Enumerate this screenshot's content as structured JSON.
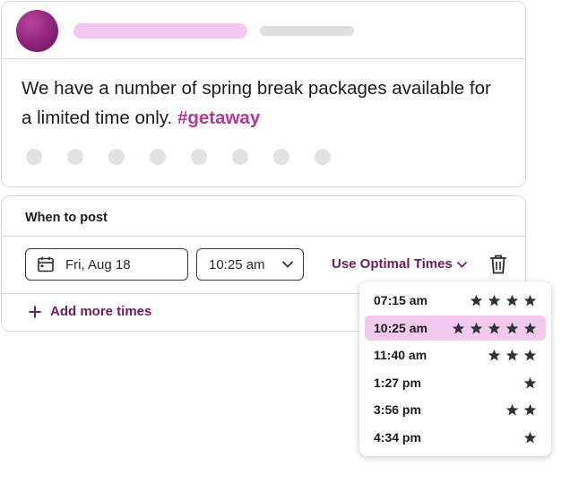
{
  "post": {
    "text": "We have a number of spring break packages available for a limited time only.",
    "hashtag": "#getaway"
  },
  "schedule": {
    "title": "When to post",
    "date_value": "Fri, Aug 18",
    "time_value": "10:25 am",
    "optimal_label": "Use Optimal Times",
    "add_more_label": "Add more times"
  },
  "optimal_times": [
    {
      "time": "07:15 am",
      "stars": 4,
      "selected": false
    },
    {
      "time": "10:25 am",
      "stars": 5,
      "selected": true
    },
    {
      "time": "11:40 am",
      "stars": 3,
      "selected": false
    },
    {
      "time": "1:27 pm",
      "stars": 1,
      "selected": false
    },
    {
      "time": "3:56 pm",
      "stars": 2,
      "selected": false
    },
    {
      "time": "4:34 pm",
      "stars": 1,
      "selected": false
    }
  ],
  "icons": {
    "calendar": "calendar-icon",
    "chevron": "chevron-down-icon",
    "trash": "trash-icon",
    "plus": "plus-icon",
    "star": "star-icon"
  },
  "colors": {
    "accent": "#6b1e5e",
    "hashtag": "#b03a98",
    "highlight": "#f3c8ee",
    "avatar": "#8c2379"
  }
}
